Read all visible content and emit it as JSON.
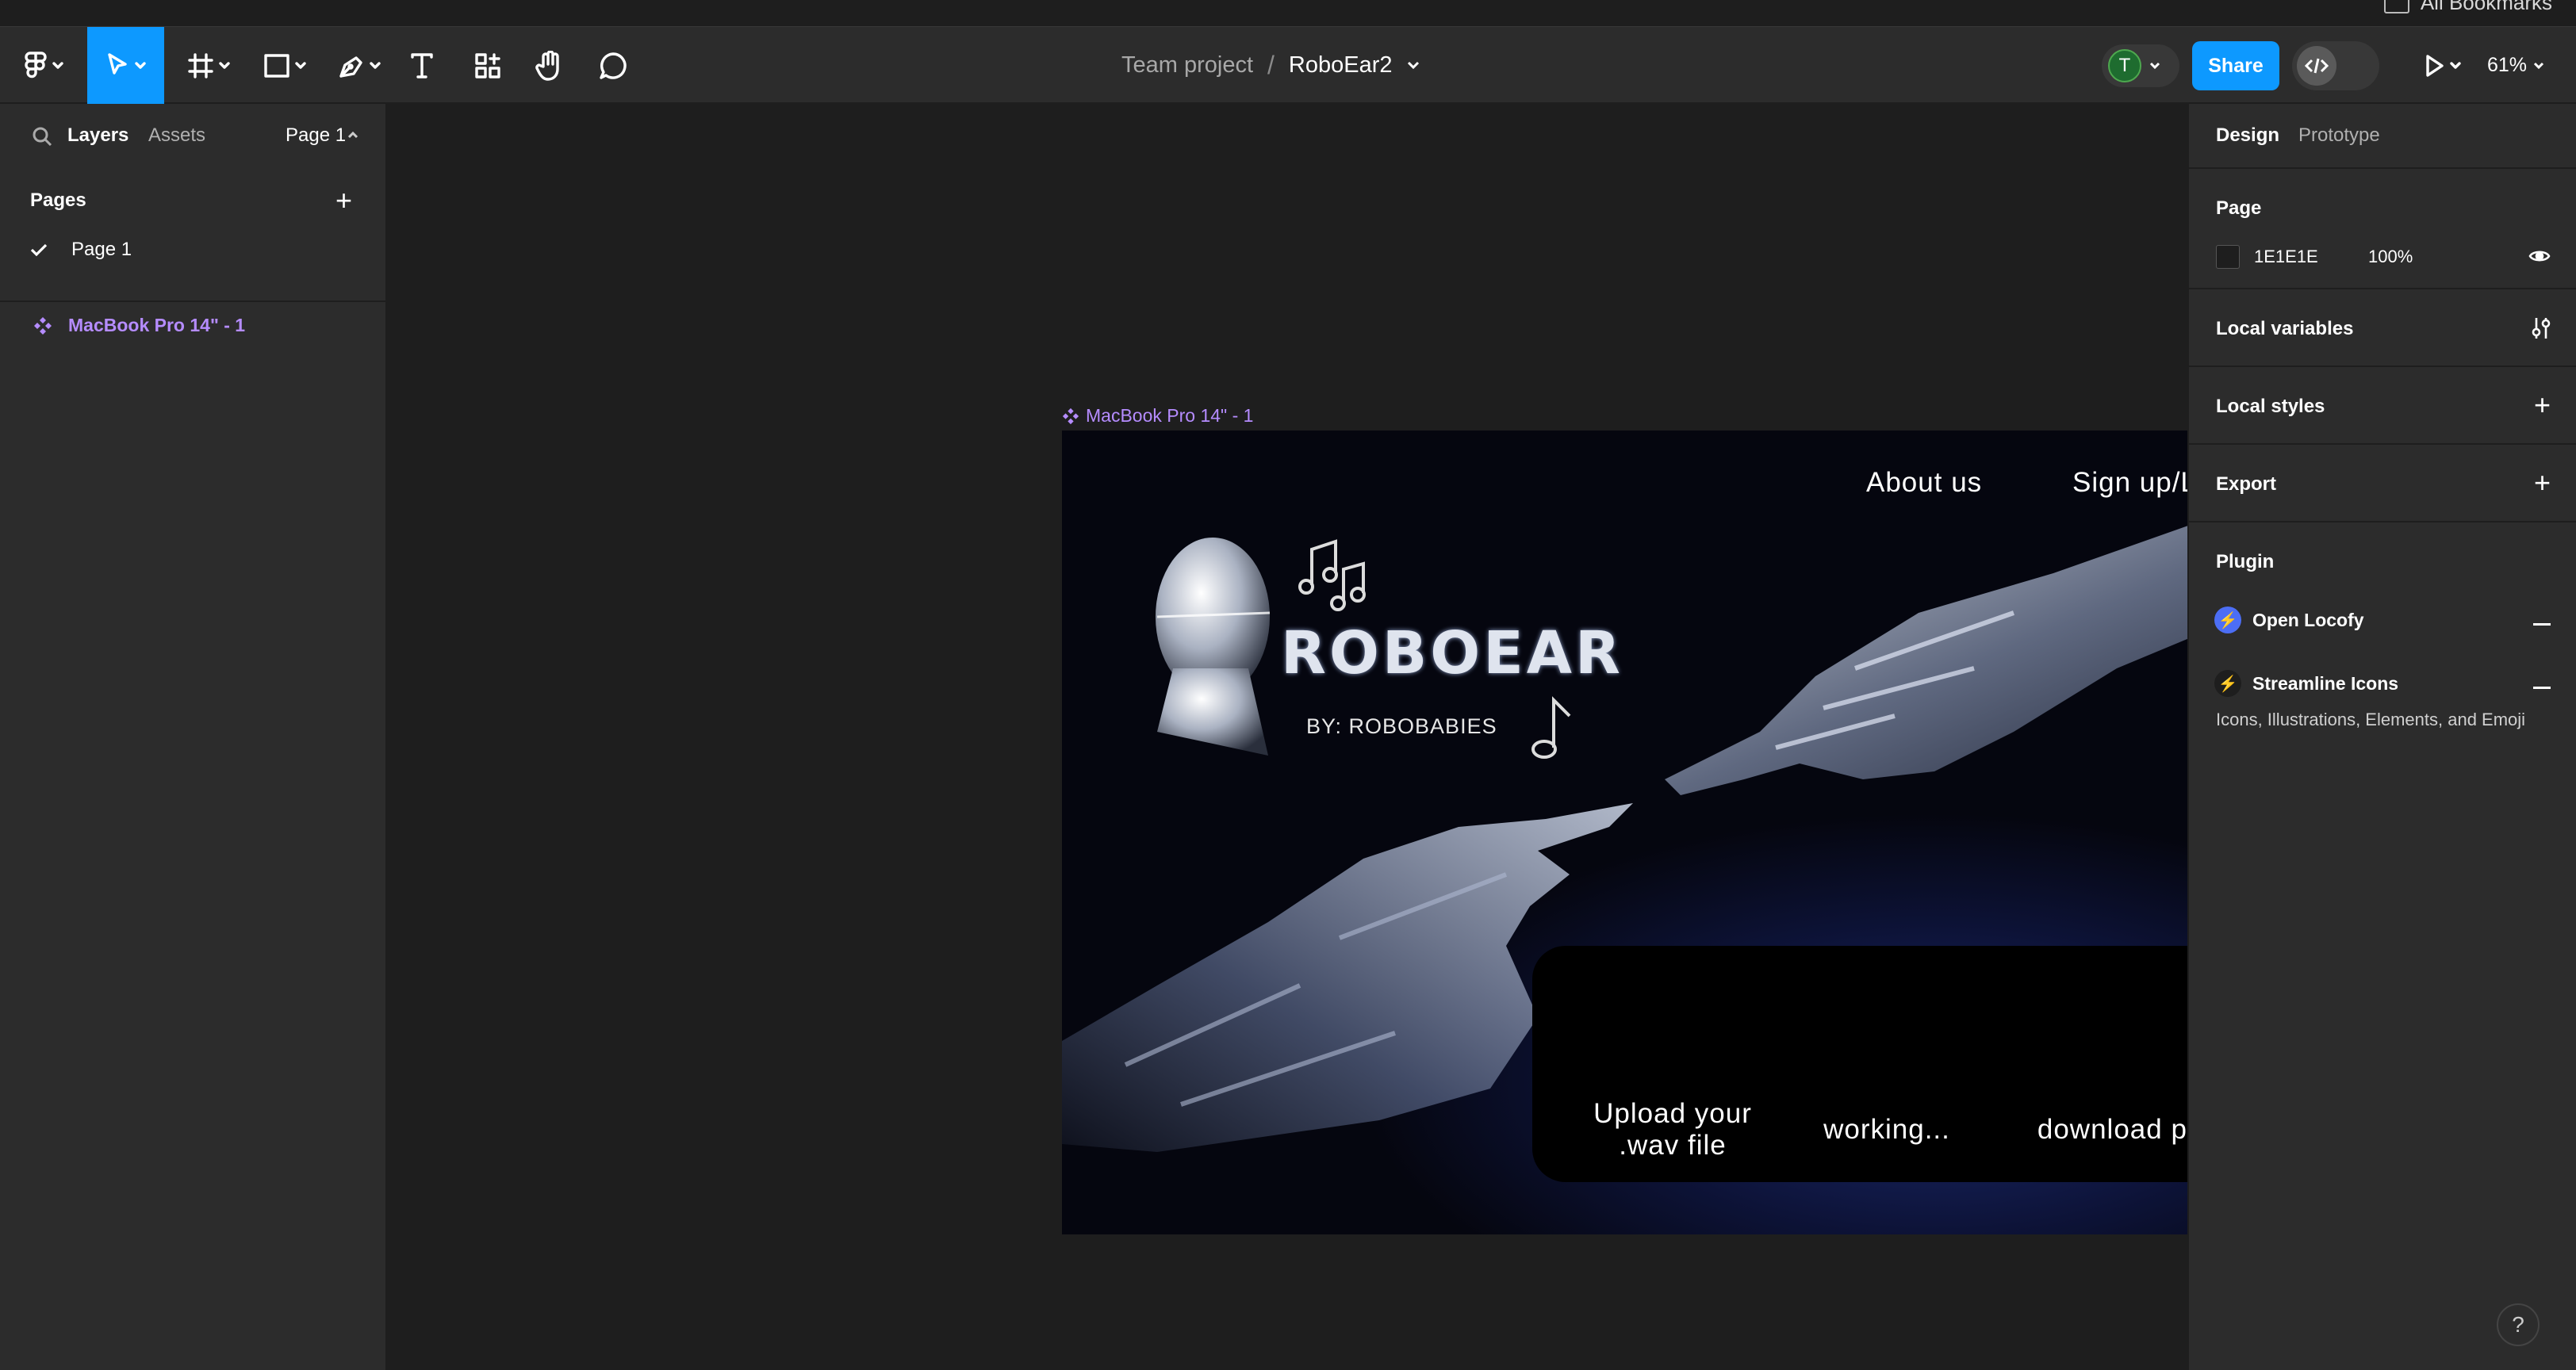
{
  "browser": {
    "bookmarks_label": "All Bookmarks"
  },
  "toolbar": {
    "file_name": "RoboEar2",
    "project_name": "Team project",
    "separator": "/",
    "avatar_initial": "T",
    "share_label": "Share",
    "zoom_label": "61%",
    "tools": [
      "main-menu",
      "move",
      "frame",
      "shape",
      "pen",
      "text",
      "actions",
      "hand",
      "comment"
    ]
  },
  "left_panel": {
    "tabs": [
      "Layers",
      "Assets"
    ],
    "page_selector": "Page 1",
    "pages_heading": "Pages",
    "pages": [
      {
        "label": "Page 1",
        "selected": true
      }
    ],
    "layers": [
      {
        "label": "MacBook Pro 14\" - 1",
        "type": "frame"
      }
    ]
  },
  "right_panel": {
    "tabs": [
      "Design",
      "Prototype"
    ],
    "page_section": {
      "title": "Page",
      "color_hex": "1E1E1E",
      "opacity": "100%"
    },
    "local_variables": "Local variables",
    "local_styles": "Local styles",
    "export": "Export",
    "plugin_title": "Plugin",
    "plugins": [
      {
        "name": "Open Locofy",
        "color": "#4c6ef5"
      },
      {
        "name": "Streamline Icons",
        "color": "#1e1e1e"
      }
    ],
    "plugin_description": "Icons, Illustrations, Elements, and Emoji"
  },
  "canvas": {
    "background": "#1e1e1e",
    "frame_label": "MacBook Pro 14\" - 1",
    "design": {
      "nav_about": "About us",
      "nav_signup": "Sign up/Login",
      "logo_title": "ROBOEAR",
      "logo_subtitle": "BY: ROBOBABIES",
      "steps": [
        {
          "line1": "Upload your",
          "line2": ".wav file"
        },
        {
          "line1": "working...",
          "line2": ""
        },
        {
          "line1": "download pdf",
          "line2": ""
        }
      ]
    }
  },
  "help_label": "?"
}
